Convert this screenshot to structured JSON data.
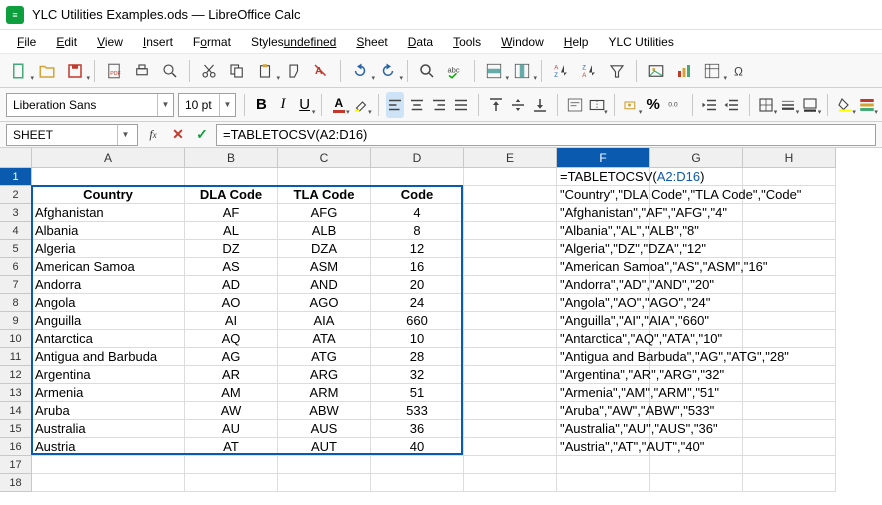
{
  "window": {
    "title": "YLC Utilities Examples.ods — LibreOffice Calc",
    "appicon_label": "≡"
  },
  "menus": [
    "File",
    "Edit",
    "View",
    "Insert",
    "Format",
    "Styles",
    "Sheet",
    "Data",
    "Tools",
    "Window",
    "Help",
    "YLC Utilities"
  ],
  "menu_underline_index": [
    0,
    0,
    0,
    0,
    1,
    7,
    0,
    0,
    0,
    0,
    0,
    -1
  ],
  "font": {
    "name": "Liberation Sans",
    "size": "10 pt"
  },
  "formula_bar": {
    "name_box": "SHEET",
    "formula": "=TABLETOCSV(A2:D16)"
  },
  "columns": [
    "A",
    "B",
    "C",
    "D",
    "E",
    "F",
    "G",
    "H"
  ],
  "selected_col_index": 5,
  "selected_row_index": 0,
  "table": {
    "header": [
      "Country",
      "DLA Code",
      "TLA Code",
      "Code"
    ],
    "rows": [
      [
        "Afghanistan",
        "AF",
        "AFG",
        "4"
      ],
      [
        "Albania",
        "AL",
        "ALB",
        "8"
      ],
      [
        "Algeria",
        "DZ",
        "DZA",
        "12"
      ],
      [
        "American Samoa",
        "AS",
        "ASM",
        "16"
      ],
      [
        "Andorra",
        "AD",
        "AND",
        "20"
      ],
      [
        "Angola",
        "AO",
        "AGO",
        "24"
      ],
      [
        "Anguilla",
        "AI",
        "AIA",
        "660"
      ],
      [
        "Antarctica",
        "AQ",
        "ATA",
        "10"
      ],
      [
        "Antigua and Barbuda",
        "AG",
        "ATG",
        "28"
      ],
      [
        "Argentina",
        "AR",
        "ARG",
        "32"
      ],
      [
        "Armenia",
        "AM",
        "ARM",
        "51"
      ],
      [
        "Aruba",
        "AW",
        "ABW",
        "533"
      ],
      [
        "Australia",
        "AU",
        "AUS",
        "36"
      ],
      [
        "Austria",
        "AT",
        "AUT",
        "40"
      ]
    ]
  },
  "f1_formula_prefix": "=TABLETOCSV(",
  "f1_formula_ref": "A2:D16",
  "f1_formula_suffix": ")",
  "csv_output": [
    "\"Country\",\"DLA Code\",\"TLA Code\",\"Code\"",
    "\"Afghanistan\",\"AF\",\"AFG\",\"4\"",
    "\"Albania\",\"AL\",\"ALB\",\"8\"",
    "\"Algeria\",\"DZ\",\"DZA\",\"12\"",
    "\"American Samoa\",\"AS\",\"ASM\",\"16\"",
    "\"Andorra\",\"AD\",\"AND\",\"20\"",
    "\"Angola\",\"AO\",\"AGO\",\"24\"",
    "\"Anguilla\",\"AI\",\"AIA\",\"660\"",
    "\"Antarctica\",\"AQ\",\"ATA\",\"10\"",
    "\"Antigua and Barbuda\",\"AG\",\"ATG\",\"28\"",
    "\"Argentina\",\"AR\",\"ARG\",\"32\"",
    "\"Armenia\",\"AM\",\"ARM\",\"51\"",
    "\"Aruba\",\"AW\",\"ABW\",\"533\"",
    "\"Australia\",\"AU\",\"AUS\",\"36\"",
    "\"Austria\",\"AT\",\"AUT\",\"40\""
  ],
  "num_rows_visible": 18,
  "icons": {
    "new": "new-doc-icon",
    "open": "open-icon",
    "save": "save-icon",
    "export": "export-pdf-icon",
    "print": "print-icon",
    "print_preview": "print-preview-icon",
    "cut": "cut-icon",
    "copy": "copy-icon",
    "paste": "paste-icon",
    "clone": "clone-format-icon",
    "undo": "undo-icon",
    "redo": "redo-icon",
    "find": "find-icon",
    "spell": "spellcheck-icon",
    "row": "row-icon",
    "col": "col-icon",
    "sort_asc": "sort-asc-icon",
    "sort_desc": "sort-desc-icon",
    "autofilter": "autofilter-icon",
    "image": "image-icon",
    "chart": "chart-icon",
    "pivot": "pivot-icon",
    "special": "special-char-icon",
    "bold": "bold-icon",
    "italic": "italic-icon",
    "underline": "underline-icon",
    "font_color": "font-color-icon",
    "highlight": "highlight-icon",
    "align_l": "align-left-icon",
    "align_c": "align-center-icon",
    "align_r": "align-right-icon",
    "align_j": "align-justify-icon",
    "valign_t": "valign-top-icon",
    "valign_m": "valign-middle-icon",
    "valign_b": "valign-bottom-icon",
    "wrap": "wrap-text-icon",
    "merge": "merge-cells-icon",
    "currency": "currency-icon",
    "percent": "percent-icon",
    "number": "number-format-icon",
    "indent_inc": "indent-inc-icon",
    "indent_dec": "indent-dec-icon",
    "borders": "borders-icon",
    "border_style": "border-style-icon",
    "bg_color": "bg-color-icon",
    "cond_format": "cond-format-icon"
  }
}
